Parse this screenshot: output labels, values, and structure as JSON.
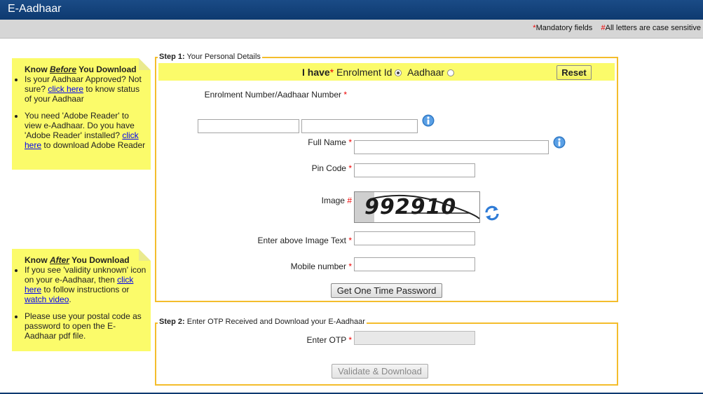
{
  "header": {
    "title": "E-Aadhaar"
  },
  "subbar": {
    "mandatory_marker": "*",
    "mandatory_text": "Mandatory fields",
    "case_marker": "#",
    "case_text": "All letters are case sensitive"
  },
  "notes": {
    "before": {
      "heading_prefix": "Know ",
      "heading_em": "Before",
      "heading_suffix": " You Download",
      "item1_text1": "Is your Aadhaar Approved? Not sure? ",
      "item1_link": "click here",
      "item1_text2": " to know status of your Aadhaar",
      "item2_text1": "You need 'Adobe Reader' to view e-Aadhaar. Do you have 'Adobe Reader' installed? ",
      "item2_link": "click here",
      "item2_text2": " to download Adobe Reader"
    },
    "after": {
      "heading_prefix": "Know ",
      "heading_em": "After",
      "heading_suffix": " You Download",
      "item1_text1": "If you see 'validity unknown' icon on your e-Aadhaar, then ",
      "item1_link": "click here",
      "item1_text2": " to follow instructions or ",
      "item1_link2": "watch video",
      "item1_text3": ".",
      "item2_text": "Please use your postal code as password to open the E-Aadhaar pdf file."
    }
  },
  "step1": {
    "legend_bold": "Step 1:",
    "legend_text": " Your Personal Details",
    "i_have": "I have",
    "star": "*",
    "enrolment_label": "Enrolment Id",
    "aadhaar_label": "Aadhaar",
    "selected": "enrolment",
    "reset": "Reset",
    "enrol_label": "Enrolment Number/Aadhaar Number",
    "enrol_value1": "",
    "enrol_value2": "",
    "full_name_label": "Full Name",
    "full_name_value": "",
    "pin_label": "Pin Code",
    "pin_value": "",
    "image_label": "Image",
    "image_marker": "#",
    "captcha_text": "992910",
    "image_text_label": "Enter above Image Text",
    "image_text_value": "",
    "mobile_label": "Mobile number",
    "mobile_value": "",
    "otp_button": "Get One Time Password"
  },
  "step2": {
    "legend_bold": "Step 2:",
    "legend_text": " Enter OTP Received and Download your E-Aadhaar",
    "otp_label": "Enter OTP",
    "otp_value": "",
    "validate_button": "Validate & Download"
  },
  "icons": {
    "info": "info-icon",
    "refresh": "refresh-icon",
    "accent": "#f4bd2c",
    "note_bg": "#fbfb6a"
  }
}
